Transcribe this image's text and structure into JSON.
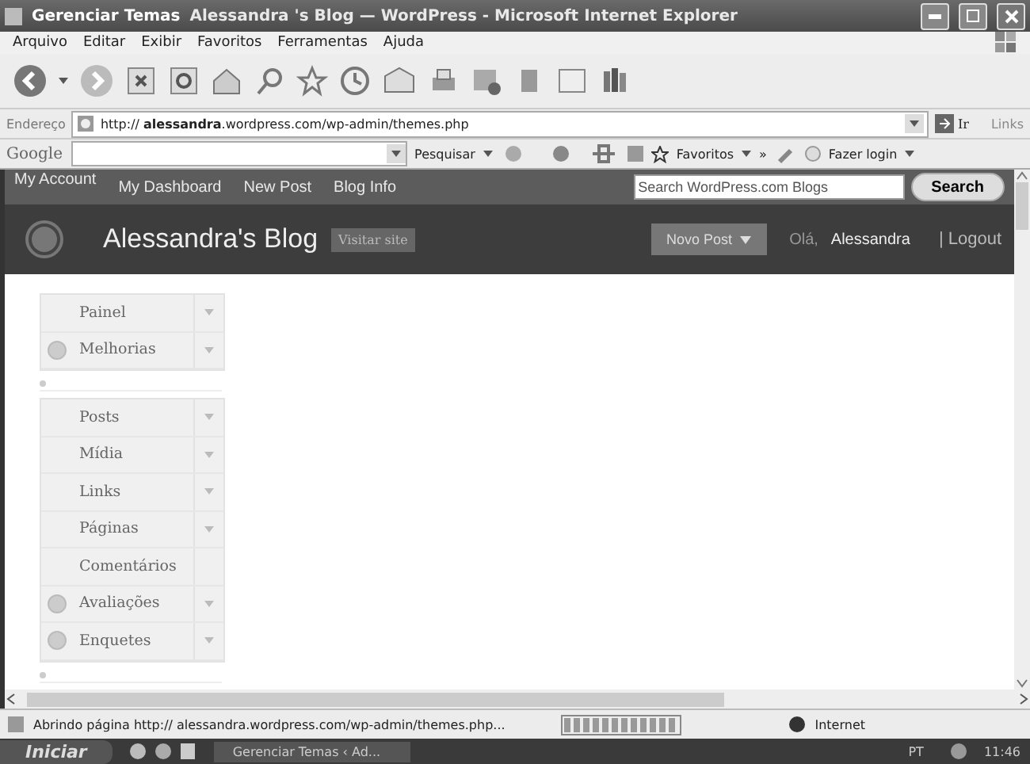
{
  "window": {
    "title_prefix": "Gerenciar Temas",
    "title": "Alessandra 's Blog — WordPress - Microsoft Internet Explorer"
  },
  "menu": [
    "Arquivo",
    "Editar",
    "Exibir",
    "Favoritos",
    "Ferramentas",
    "Ajuda"
  ],
  "address": {
    "label": "Endereço",
    "host": "alessandra",
    "url_before": "http:// ",
    "url_after": ".wordpress.com/wp-admin/themes.php",
    "go": "Ir",
    "links": "Links"
  },
  "google_bar": {
    "logo": "Google",
    "search": "Pesquisar",
    "favorites": "Favoritos",
    "more": "»",
    "login": "Fazer login"
  },
  "admin_bar": {
    "items": [
      "My Account",
      "My Dashboard",
      "New Post",
      "Blog Info"
    ],
    "search_placeholder": "Search WordPress.com Blogs",
    "search_button": "Search"
  },
  "header": {
    "blog_title": "Alessandra's Blog",
    "visit": "Visitar site",
    "new_post": "Novo Post",
    "greeting": "Olá,",
    "user": "Alessandra",
    "logout": "| Logout"
  },
  "menu_groups": [
    [
      {
        "label": "Painel",
        "icon": false,
        "arrow": true
      },
      {
        "label": "Melhorias",
        "icon": true,
        "arrow": true
      }
    ],
    [
      {
        "label": "Posts",
        "icon": false,
        "arrow": true
      },
      {
        "label": "Mídia",
        "icon": false,
        "arrow": true
      },
      {
        "label": "Links",
        "icon": false,
        "arrow": true
      },
      {
        "label": "Páginas",
        "icon": false,
        "arrow": true
      },
      {
        "label": "Comentários",
        "icon": false,
        "arrow": false
      },
      {
        "label": "Avaliações",
        "icon": true,
        "arrow": true
      },
      {
        "label": "Enquetes",
        "icon": true,
        "arrow": true
      }
    ]
  ],
  "status_bar": {
    "text": "Abrindo página http://  alessandra.wordpress.com/wp-admin/themes.php...",
    "level": 1,
    "zone": "Internet"
  },
  "taskbar": {
    "start": "Iniciar",
    "task": "Gerenciar Temas ‹ Ad...",
    "lang": "PT",
    "time": "11:46"
  }
}
